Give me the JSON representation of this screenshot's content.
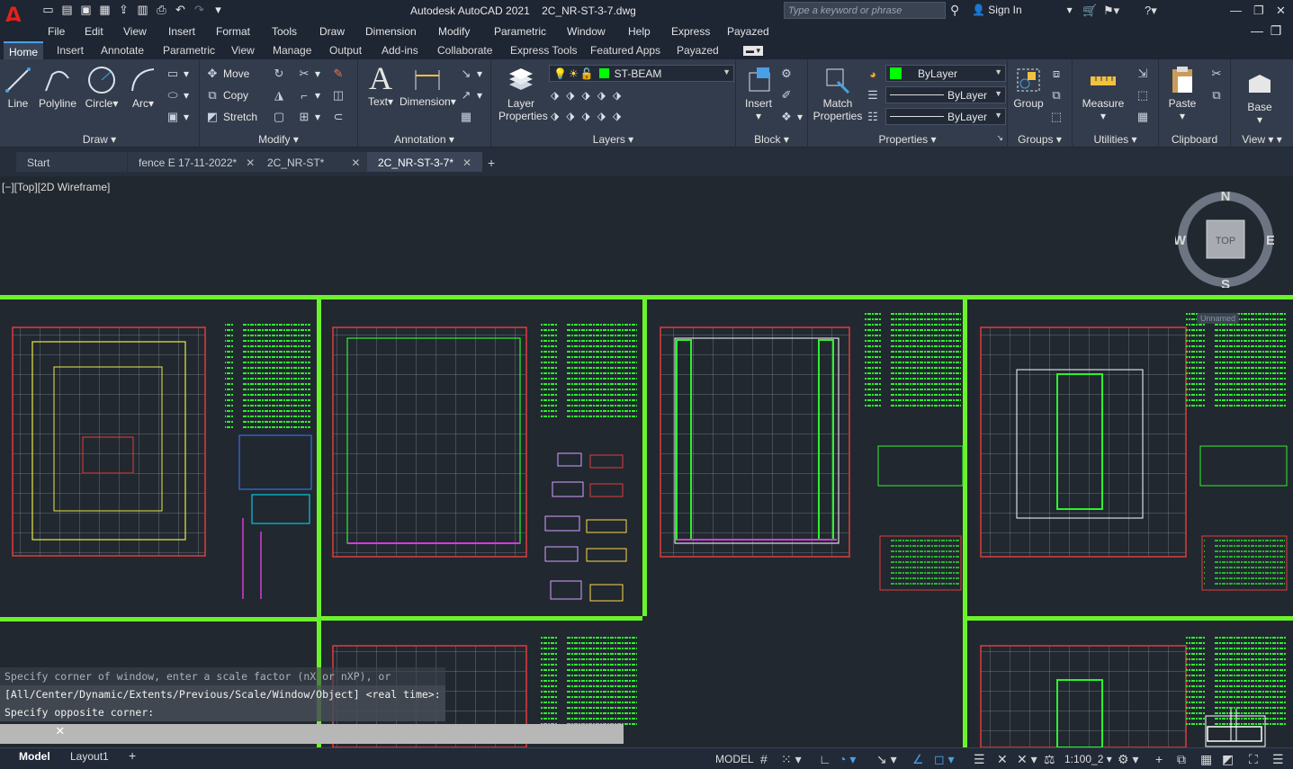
{
  "app": {
    "title": "Autodesk AutoCAD 2021",
    "filename": "2C_NR-ST-3-7.dwg",
    "search_placeholder": "Type a keyword or phrase",
    "sign_in": "Sign In"
  },
  "menubar": [
    "File",
    "Edit",
    "View",
    "Insert",
    "Format",
    "Tools",
    "Draw",
    "Dimension",
    "Modify",
    "Parametric",
    "Window",
    "Help",
    "Express",
    "Payazed"
  ],
  "ribbon_tabs": [
    "Home",
    "Insert",
    "Annotate",
    "Parametric",
    "View",
    "Manage",
    "Output",
    "Add-ins",
    "Collaborate",
    "Express Tools",
    "Featured Apps",
    "Payazed"
  ],
  "ribbon": {
    "draw": {
      "title": "Draw",
      "line": "Line",
      "polyline": "Polyline",
      "circle": "Circle",
      "arc": "Arc"
    },
    "modify": {
      "title": "Modify",
      "move": "Move",
      "copy": "Copy",
      "stretch": "Stretch"
    },
    "annotation": {
      "title": "Annotation",
      "text": "Text",
      "dimension": "Dimension"
    },
    "layers": {
      "title": "Layers",
      "layer_properties": "Layer Properties",
      "current_layer": "ST-BEAM",
      "layer_color": "#00ff00"
    },
    "block": {
      "title": "Block",
      "insert": "Insert"
    },
    "properties": {
      "title": "Properties",
      "match": "Match Properties",
      "color": "ByLayer",
      "linetype": "ByLayer",
      "lineweight": "ByLayer"
    },
    "groups": {
      "title": "Groups",
      "group": "Group"
    },
    "utilities": {
      "title": "Utilities",
      "measure": "Measure"
    },
    "clipboard": {
      "title": "Clipboard",
      "paste": "Paste"
    },
    "view": {
      "title": "View",
      "base": "Base"
    }
  },
  "doc_tabs": [
    "Start",
    "fence E 17-11-2022*",
    "2C_NR-ST*",
    "2C_NR-ST-3-7*"
  ],
  "viewport_label": "[−][Top][2D Wireframe]",
  "viewcube": {
    "n": "N",
    "s": "S",
    "e": "E",
    "w": "W",
    "top": "TOP"
  },
  "unsaved_label": "Unnamed",
  "command_history": [
    "Specify corner of window, enter a scale factor (nX or nXP), or",
    "[All/Center/Dynamic/Extents/Previous/Scale/Window/Object] <real time>:",
    "Specify opposite corner:"
  ],
  "status": {
    "model_tab": "Model",
    "layout_tab": "Layout1",
    "mode": "MODEL",
    "scale": "1:100_2"
  },
  "colors": {
    "frame": "#6cf22a",
    "accent": "#e2231a"
  }
}
